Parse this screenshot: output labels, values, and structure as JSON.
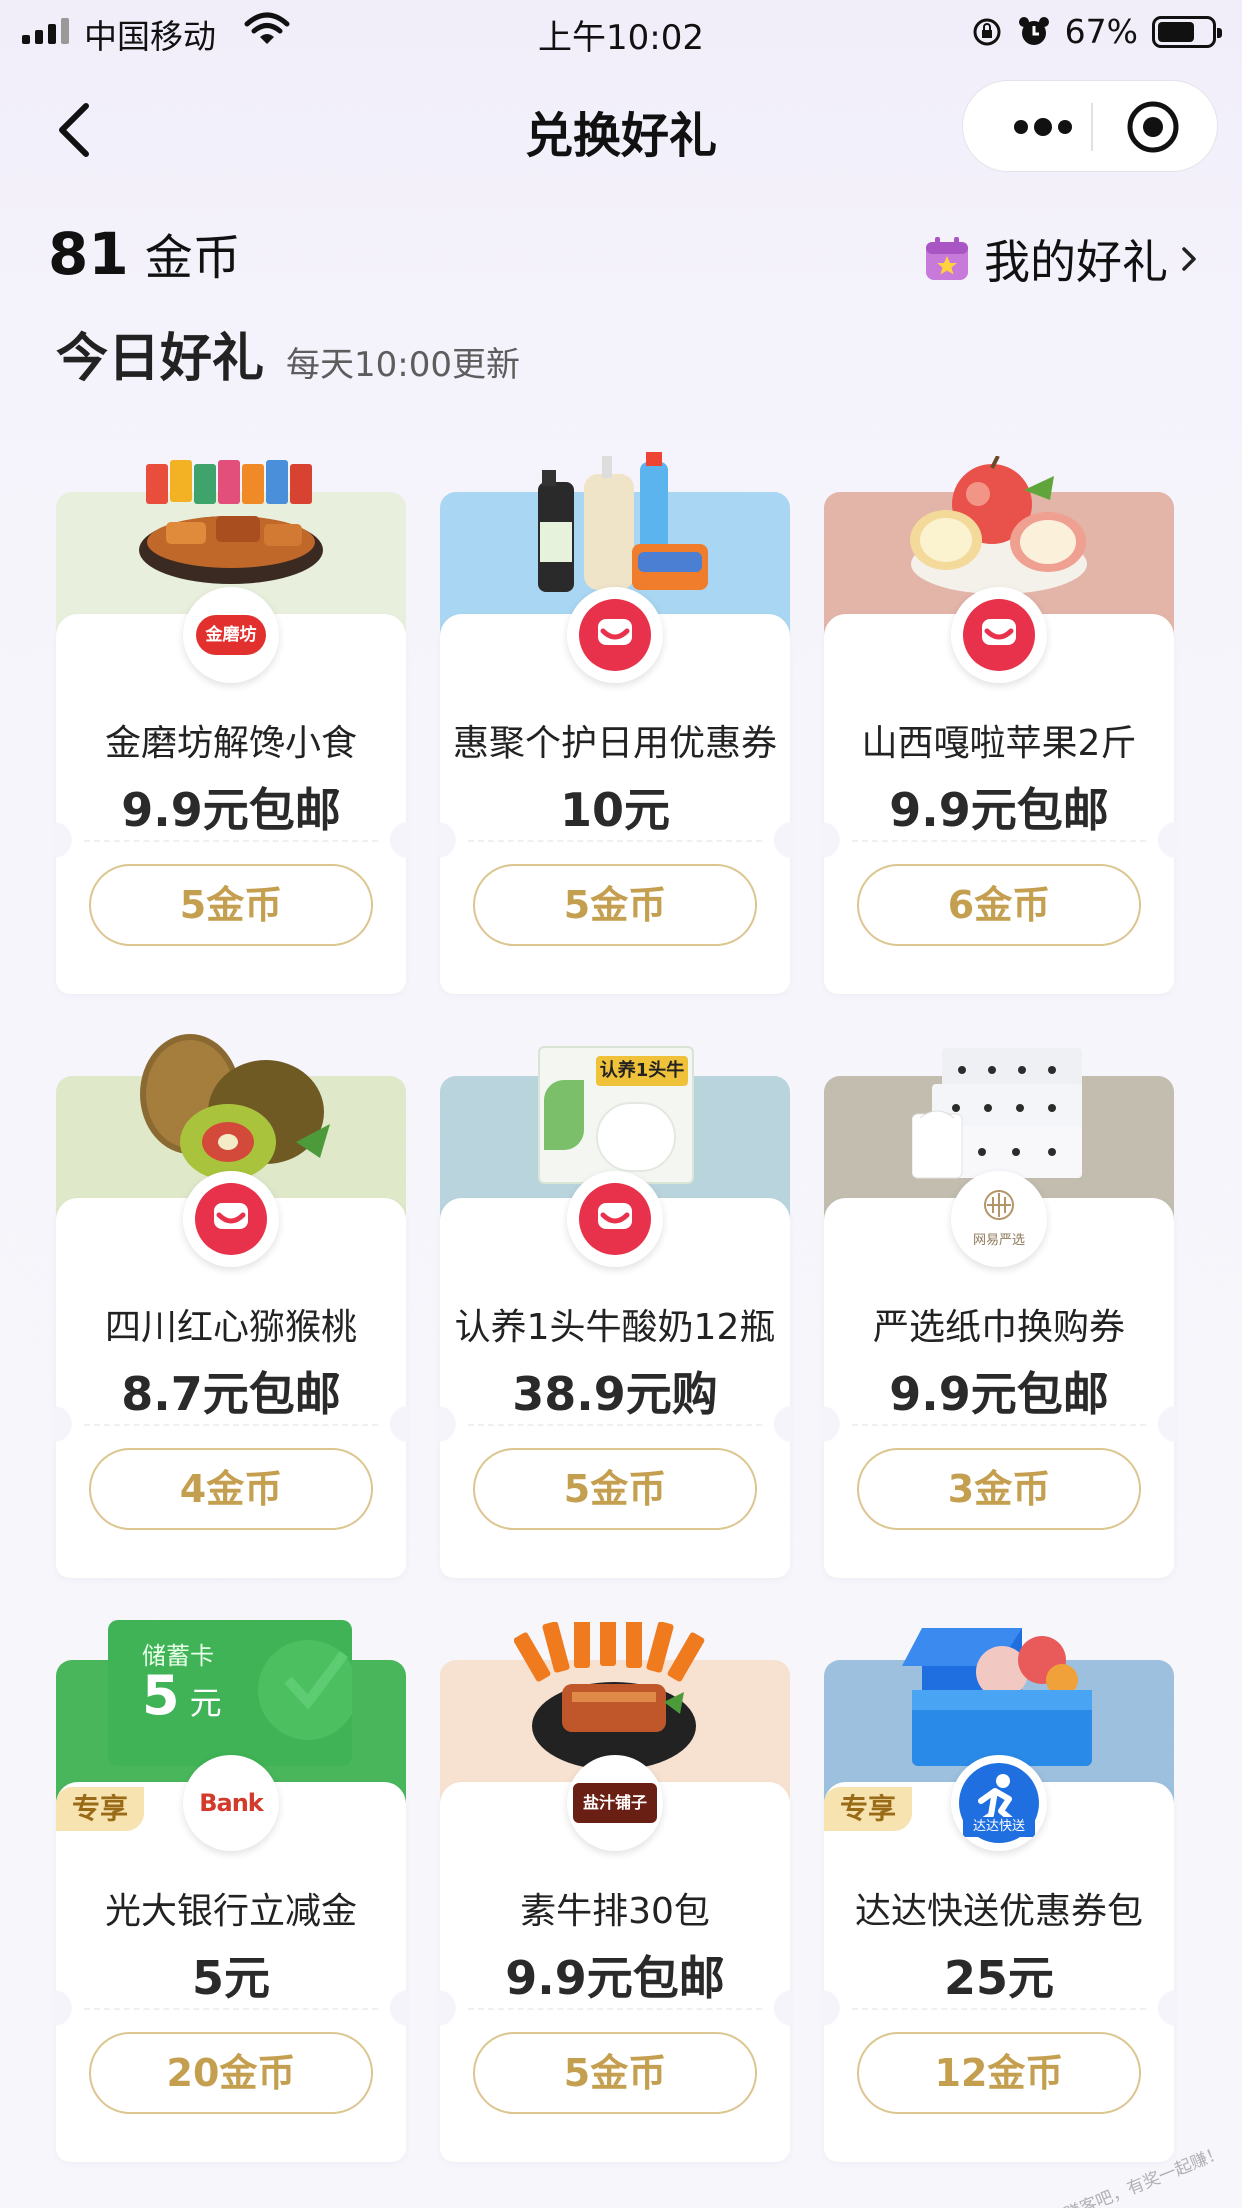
{
  "status_bar": {
    "carrier": "中国移动",
    "time": "上午10:02",
    "battery": "67%"
  },
  "nav": {
    "title": "兑换好礼"
  },
  "coins": {
    "value": "81",
    "unit": "金币"
  },
  "my_gifts": {
    "label": "我的好礼"
  },
  "section": {
    "title": "今日好礼",
    "subtitle": "每天10:00更新"
  },
  "items": [
    {
      "name": "金磨坊解馋小食",
      "price": "9.9元包邮",
      "cost": "5金币",
      "logo": "金磨坊",
      "band_color": "#e8efdc"
    },
    {
      "name": "惠聚个护日用优惠券",
      "price": "10元",
      "cost": "5金币",
      "band_color": "#a9d6f2"
    },
    {
      "name": "山西嘎啦苹果2斤",
      "price": "9.9元包邮",
      "cost": "6金币",
      "band_color": "#e3b4a8"
    },
    {
      "name": "四川红心猕猴桃",
      "price": "8.7元包邮",
      "cost": "4金币",
      "band_color": "#dfe8c9"
    },
    {
      "name": "认养1头牛酸奶12瓶",
      "price": "38.9元购",
      "cost": "5金币",
      "band_color": "#b9d4dd",
      "product_label": "认养1头牛"
    },
    {
      "name": "严选纸巾换购券",
      "price": "9.9元包邮",
      "cost": "3金币",
      "logo": "网易严选",
      "band_color": "#c2bdae"
    },
    {
      "name": "光大银行立减金",
      "price": "5元",
      "cost": "20金币",
      "tag": "专享",
      "logo": "Bank",
      "band_color": "#49b65c",
      "card_title": "储蓄卡",
      "card_amount": "5",
      "card_unit": "元"
    },
    {
      "name": "素牛排30包",
      "price": "9.9元包邮",
      "cost": "5金币",
      "logo": "盐汁铺子",
      "band_color": "#f7e1d0"
    },
    {
      "name": "达达快送优惠券包",
      "price": "25元",
      "cost": "12金币",
      "tag": "专享",
      "logo": "达达快送",
      "band_color": "#9cc0dd"
    }
  ],
  "colors": {
    "accent_gold": "#c49f4f",
    "button_border": "#dcc590",
    "brand_red": "#e8314b",
    "tag_bg": "#f7e3b0"
  },
  "watermark": "赚客吧，有奖一起赚！"
}
